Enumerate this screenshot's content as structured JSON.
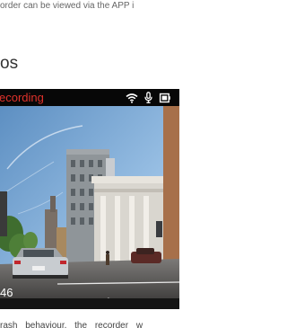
{
  "caption_top": "order can be viewed via the APP i",
  "section_heading": "os",
  "camera": {
    "status_text": "ecording",
    "counter_text": "46",
    "status_icons": [
      "wifi-icon",
      "microphone-icon",
      "battery-icon"
    ],
    "status_color": "#e0322b"
  },
  "caption_bottom": "rash  behaviour,  the  recorder  w"
}
